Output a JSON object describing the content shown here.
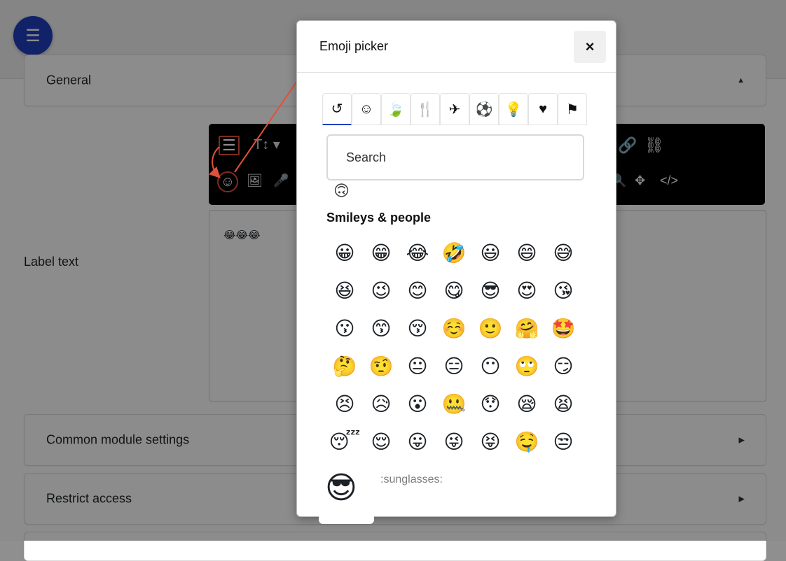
{
  "page": {
    "menu_icon": "hamburger-icon",
    "sections": {
      "general": {
        "title": "General",
        "caret": "▲"
      },
      "common": {
        "title": "Common module settings",
        "caret": "▶"
      },
      "restrict": {
        "title": "Restrict access",
        "caret": "▶"
      }
    },
    "label_text": "Label text",
    "editor_content": "😂😂😂"
  },
  "toolbar": {
    "row1": [
      "☰",
      "T↕ ▾",
      "🔗",
      "⛓"
    ],
    "row2": [
      "☺",
      "🖼",
      "🎤",
      "🔍",
      "✥",
      "</>"
    ]
  },
  "modal": {
    "title": "Emoji picker",
    "close": "×",
    "categories": [
      {
        "icon": "history-icon",
        "glyph": "↺"
      },
      {
        "icon": "smiley-icon",
        "glyph": "☺"
      },
      {
        "icon": "leaf-icon",
        "glyph": "🍃"
      },
      {
        "icon": "food-icon",
        "glyph": "🍴"
      },
      {
        "icon": "plane-icon",
        "glyph": "✈"
      },
      {
        "icon": "ball-icon",
        "glyph": "⚽"
      },
      {
        "icon": "lightbulb-icon",
        "glyph": "💡"
      },
      {
        "icon": "heart-icon",
        "glyph": "♥"
      },
      {
        "icon": "flag-icon",
        "glyph": "⚑"
      }
    ],
    "search_placeholder": "Search",
    "section_heading": "Smileys & people",
    "emojis": [
      "😀",
      "😁",
      "😂",
      "🤣",
      "😃",
      "😄",
      "😅",
      "😆",
      "😉",
      "😊",
      "😋",
      "😎",
      "😍",
      "😘",
      "😗",
      "😙",
      "😚",
      "☺️",
      "🙂",
      "🤗",
      "🤩",
      "🤔",
      "🤨",
      "😐",
      "😑",
      "😶",
      "🙄",
      "😏",
      "😣",
      "😥",
      "😮",
      "🤐",
      "😯",
      "😪",
      "😫",
      "😴",
      "😌",
      "😛",
      "😜",
      "😝",
      "🤤",
      "😒"
    ],
    "preview": {
      "emoji": "😎",
      "name": ":sunglasses:"
    }
  }
}
